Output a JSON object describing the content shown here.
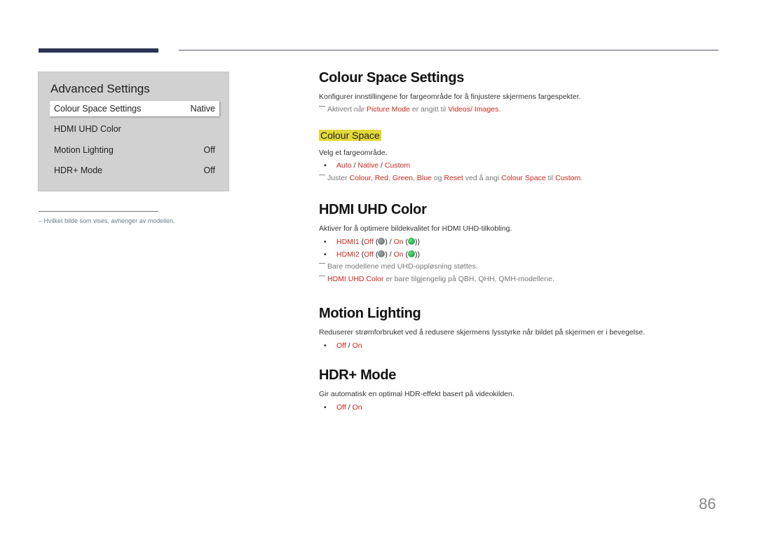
{
  "menu": {
    "title": "Advanced Settings",
    "items": [
      {
        "label": "Colour Space Settings",
        "value": "Native",
        "selected": true
      },
      {
        "label": "HDMI UHD Color",
        "value": ""
      },
      {
        "label": "Motion Lighting",
        "value": "Off"
      },
      {
        "label": "HDR+ Mode",
        "value": "Off"
      }
    ]
  },
  "footnote": "–  Hvilket bilde som vises, avhenger av modellen.",
  "colour_space_settings": {
    "title": "Colour Space Settings",
    "desc": "Konfigurer innstillingene for fargeområde for å finjustere skjermens fargespekter.",
    "note": {
      "pre": "Aktivert når ",
      "link1": "Picture Mode",
      "mid": " er angitt til ",
      "link2": "Videos/ Images",
      "post": "."
    },
    "sub": {
      "title": "Colour Space",
      "desc": "Velg et fargeområde.",
      "options": [
        "Auto",
        "Native",
        "Custom"
      ],
      "note": {
        "pre": "Juster ",
        "colour": "Colour",
        "red": "Red",
        "green": "Green",
        "blue": "Blue",
        "og": " og ",
        "reset": "Reset",
        "mid": " ved å angi ",
        "cs": "Colour Space",
        "til": " til ",
        "custom": "Custom",
        "post": "."
      }
    }
  },
  "hdmi_uhd": {
    "title": "HDMI UHD Color",
    "desc": "Aktiver for å optimere bildekvalitet for HDMI UHD-tilkobling.",
    "ports": [
      {
        "name": "HDMI1",
        "off": "Off",
        "on": "On"
      },
      {
        "name": "HDMI2",
        "off": "Off",
        "on": "On"
      }
    ],
    "note1": "Bare modellene med UHD-oppløsning støttes.",
    "note2_link": "HDMI UHD Color",
    "note2_text": " er bare tilgjengelig på QBH, QHH, QMH-modellene."
  },
  "motion_lighting": {
    "title": "Motion Lighting",
    "desc": "Reduserer strømforbruket ved å redusere skjermens lysstyrke når bildet på skjermen er i bevegelse.",
    "off": "Off",
    "on": "On"
  },
  "hdr_mode": {
    "title": "HDR+ Mode",
    "desc": "Gir automatisk en optimal HDR-effekt basert på videokilden.",
    "off": "Off",
    "on": "On"
  },
  "page_number": "86"
}
